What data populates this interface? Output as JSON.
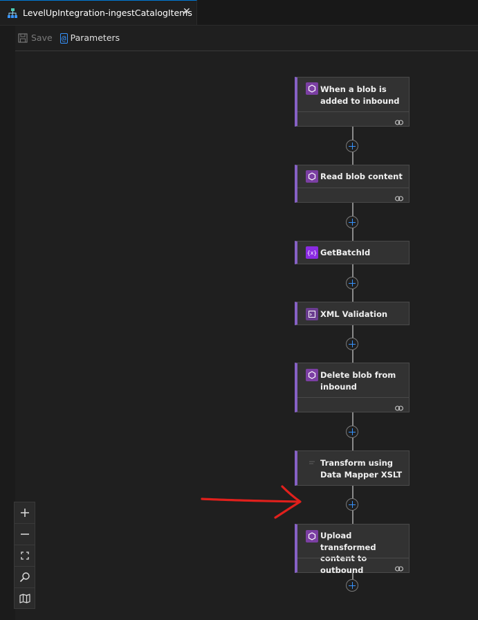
{
  "tab": {
    "title": "LevelUpIntegration-ingestCatalogItems",
    "close": "✕"
  },
  "toolbar": {
    "save_label": "Save",
    "parameters_label": "Parameters"
  },
  "workflow": {
    "trigger": {
      "title": "When a blob is added to inbound"
    },
    "actions": [
      {
        "title": "Read blob content"
      },
      {
        "title": "GetBatchId"
      },
      {
        "title": "XML Validation"
      },
      {
        "title": "Delete blob from inbound"
      },
      {
        "title": "Transform using Data Mapper XSLT"
      },
      {
        "title": "Upload transformed content to outbound"
      }
    ]
  },
  "zoom_controls": [
    "zoom-in",
    "zoom-out",
    "fit-view",
    "search",
    "minimap"
  ],
  "colors": {
    "accent": "#8661c5",
    "plus": "#3794ff",
    "annotation": "#e0201c"
  }
}
